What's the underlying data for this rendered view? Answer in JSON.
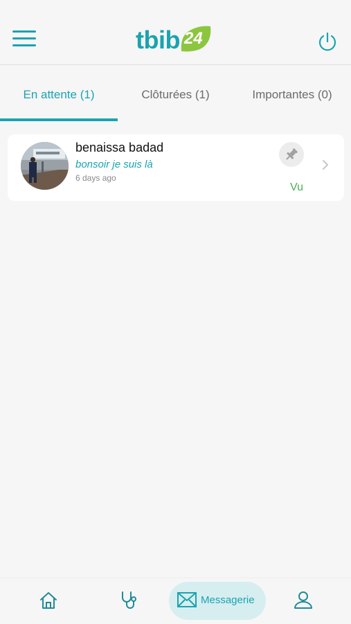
{
  "header": {
    "logo_text": "tbib",
    "logo_number": "24",
    "brand_color": "#1aa3b0",
    "badge_color": "#8cc63f",
    "menu_icon": "hamburger-menu-icon",
    "power_icon": "power-icon"
  },
  "tabs": [
    {
      "label": "En attente (1)",
      "active": true
    },
    {
      "label": "Clôturées (1)",
      "active": false
    },
    {
      "label": "Importantes (0)",
      "active": false
    }
  ],
  "conversations": [
    {
      "name": "benaissa badad",
      "message": "bonsoir je suis là",
      "time": "6 days ago",
      "status": "Vu",
      "status_color": "#4caf50",
      "pin_icon": "pin-icon",
      "chevron_icon": "chevron-right-icon"
    }
  ],
  "bottom_nav": {
    "items": [
      {
        "icon": "home-icon"
      },
      {
        "icon": "stethoscope-icon"
      },
      {
        "icon": "mail-icon",
        "label": "Messagerie",
        "active": true
      },
      {
        "icon": "user-icon"
      }
    ]
  }
}
